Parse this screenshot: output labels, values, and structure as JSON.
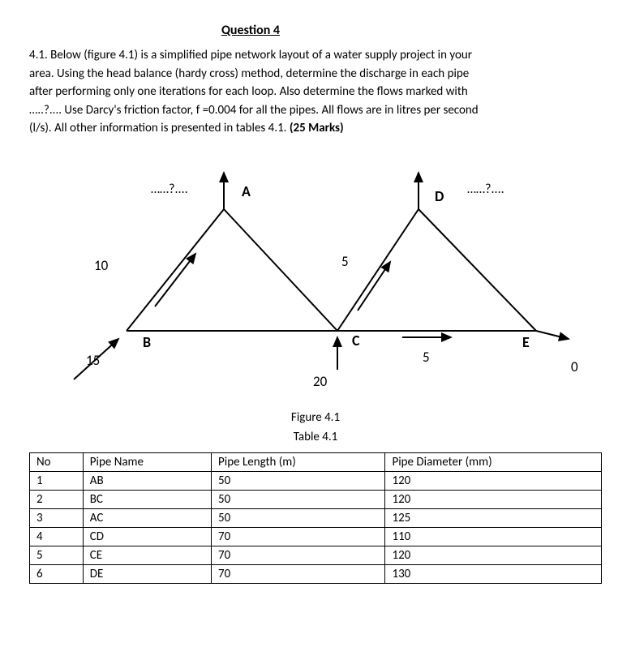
{
  "title": "Question 4",
  "body_lines": [
    "4.1. Below (figure 4.1) is a simplified pipe network layout of a water supply project in your",
    "area. Using the head balance (hardy cross) method, determine the discharge in each pipe",
    "after performing only one iterations for each loop. Also determine the flows marked with",
    "…..?.... Use Darcy's friction factor, f =0.004 for all the pipes. All flows are in litres per second",
    "(l/s). All other information is presented in tables 4.1. "
  ],
  "marks": "(25 Marks)",
  "figure": {
    "caption": "Figure 4.1",
    "nodes": {
      "A": "A",
      "B": "B",
      "C": "C",
      "D": "D",
      "E": "E"
    },
    "labels": {
      "q_left": "……?....",
      "q_right": "……?....",
      "ten": "10",
      "five_ac": "5",
      "fifteen": "15",
      "twenty": "20",
      "five_ce": "5",
      "zero": "0"
    }
  },
  "table": {
    "caption": "Table 4.1",
    "headers": [
      "No",
      "Pipe Name",
      "Pipe Length (m)",
      "Pipe Diameter (mm)"
    ],
    "rows": [
      [
        "1",
        "AB",
        "50",
        "120"
      ],
      [
        "2",
        "BC",
        "50",
        "120"
      ],
      [
        "3",
        "AC",
        "50",
        "125"
      ],
      [
        "4",
        "CD",
        "70",
        "110"
      ],
      [
        "5",
        "CE",
        "70",
        "120"
      ],
      [
        "6",
        "DE",
        "70",
        "130"
      ]
    ]
  }
}
